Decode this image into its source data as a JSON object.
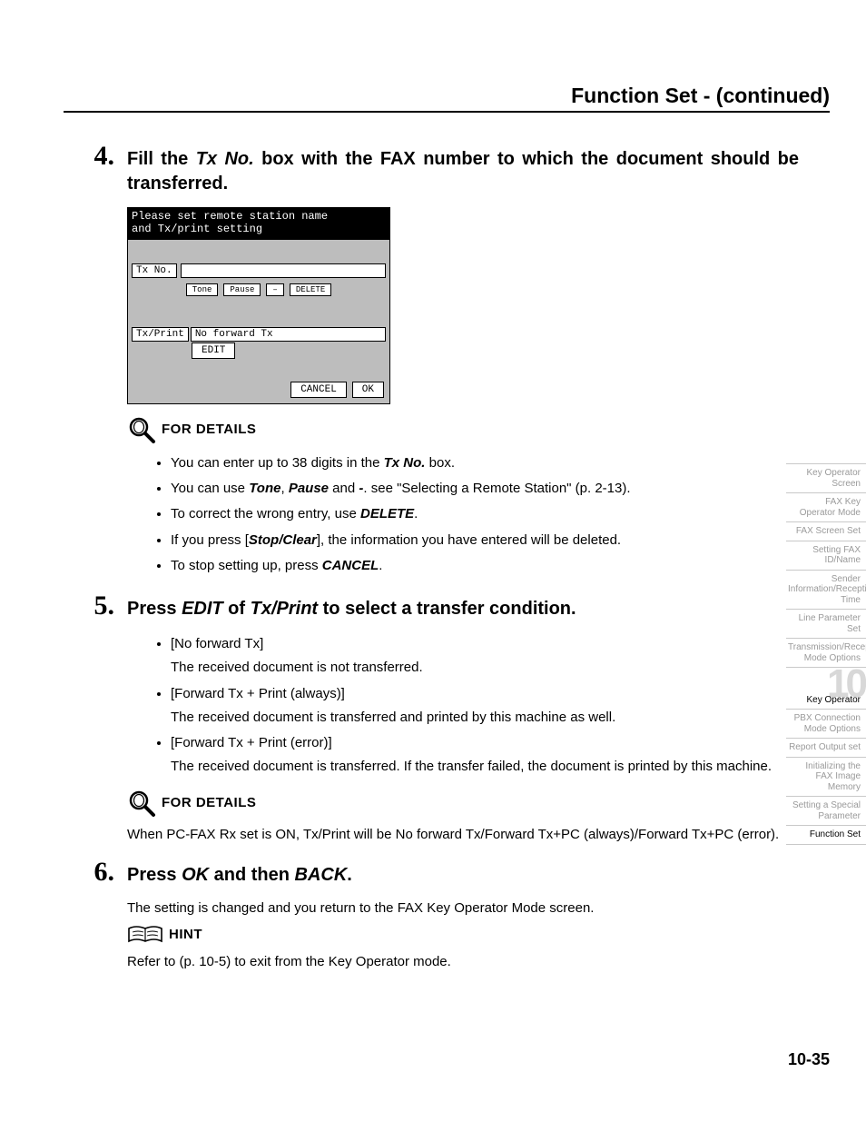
{
  "header": {
    "title": "Function Set -  (continued)"
  },
  "steps": {
    "s4": {
      "num": "4.",
      "title_pre": "Fill the ",
      "title_em": "Tx No.",
      "title_post": " box with the FAX number to which the document should be transferred.",
      "mock": {
        "black_line1": "Please set remote station name",
        "black_line2": "and Tx/print setting",
        "txno_label": "Tx No.",
        "btn_tone": "Tone",
        "btn_pause": "Pause",
        "btn_dash": "–",
        "btn_delete": "DELETE",
        "txprint_label": "Tx/Print",
        "txprint_value": "No forward Tx",
        "btn_edit": "EDIT",
        "btn_cancel": "CANCEL",
        "btn_ok": "OK"
      },
      "details_label": "FOR DETAILS",
      "details": {
        "d1_pre": "You can enter up to 38 digits in the ",
        "d1_em": "Tx No.",
        "d1_post": " box.",
        "d2_pre": "You can use ",
        "d2_em1": "Tone",
        "d2_mid1": ", ",
        "d2_em2": "Pause",
        "d2_mid2": " and ",
        "d2_em3": "-",
        "d2_post": ". see \"Selecting a Remote Station\" (p. 2-13).",
        "d3_pre": "To correct the wrong entry, use ",
        "d3_em": "DELETE",
        "d3_post": ".",
        "d4_pre": "If you press [",
        "d4_em": "Stop/Clear",
        "d4_post": "], the information you have entered will be deleted.",
        "d5_pre": "To stop setting up, press ",
        "d5_em": "CANCEL",
        "d5_post": "."
      }
    },
    "s5": {
      "num": "5.",
      "title_pre": "Press ",
      "title_em1": "EDIT",
      "title_mid": " of ",
      "title_em2": "Tx/Print",
      "title_post": " to select a transfer condition.",
      "items": {
        "i1_head": "[No forward Tx]",
        "i1_body": "The received document is not transferred.",
        "i2_head": "[Forward Tx + Print (always)]",
        "i2_body": "The received document is transferred and printed by this machine as well.",
        "i3_head": "[Forward Tx + Print (error)]",
        "i3_body": "The received document is transferred. If the transfer failed, the document is printed by this machine."
      },
      "details_label": "FOR DETAILS",
      "details_para": "When PC-FAX Rx set is ON, Tx/Print will be No forward Tx/Forward Tx+PC (always)/Forward Tx+PC (error)."
    },
    "s6": {
      "num": "6.",
      "title_pre": "Press ",
      "title_em1": "OK",
      "title_mid": " and then ",
      "title_em2": "BACK",
      "title_post": ".",
      "para": "The setting is changed and you return to the FAX Key Operator Mode screen.",
      "hint_label": "HINT",
      "hint_para": "Refer to (p. 10-5) to exit from the Key Operator mode."
    }
  },
  "sidebar": {
    "t1": "Key Operator Screen",
    "t2": "FAX Key Operator Mode",
    "t3": "FAX Screen Set",
    "t4": "Setting FAX ID/Name",
    "t5": "Sender Information/Reception Time",
    "t6": "Line Parameter Set",
    "t7": "Transmission/Reception Mode Options",
    "chapter_num": "10",
    "chapter_label": "Key Operator",
    "t8": "PBX Connection Mode Options",
    "t9": "Report Output set",
    "t10": "Initializing the FAX Image Memory",
    "t11": "Setting a Special Parameter",
    "t12": "Function Set"
  },
  "page_number": "10-35"
}
